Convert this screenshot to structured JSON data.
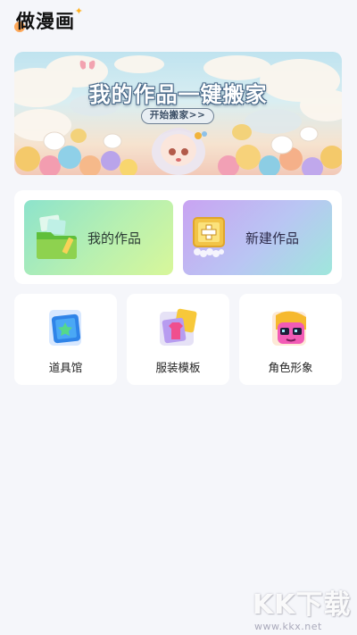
{
  "app": {
    "title": "做漫画"
  },
  "banner": {
    "title": "我的作品一键搬家",
    "button_label": "开始搬家>>"
  },
  "main": {
    "my_works_label": "我的作品",
    "new_work_label": "新建作品"
  },
  "tools": [
    {
      "label": "道具馆",
      "icon": "prop-shop-icon"
    },
    {
      "label": "服装模板",
      "icon": "costume-template-icon"
    },
    {
      "label": "角色形象",
      "icon": "character-icon"
    }
  ],
  "watermark": {
    "text": "KK下载",
    "url": "www.kkx.net"
  },
  "colors": {
    "background": "#f5f6fa",
    "works_tile": "#b8f0b0",
    "create_tile": "#c9a3f2",
    "accent": "#ff9a3c"
  }
}
